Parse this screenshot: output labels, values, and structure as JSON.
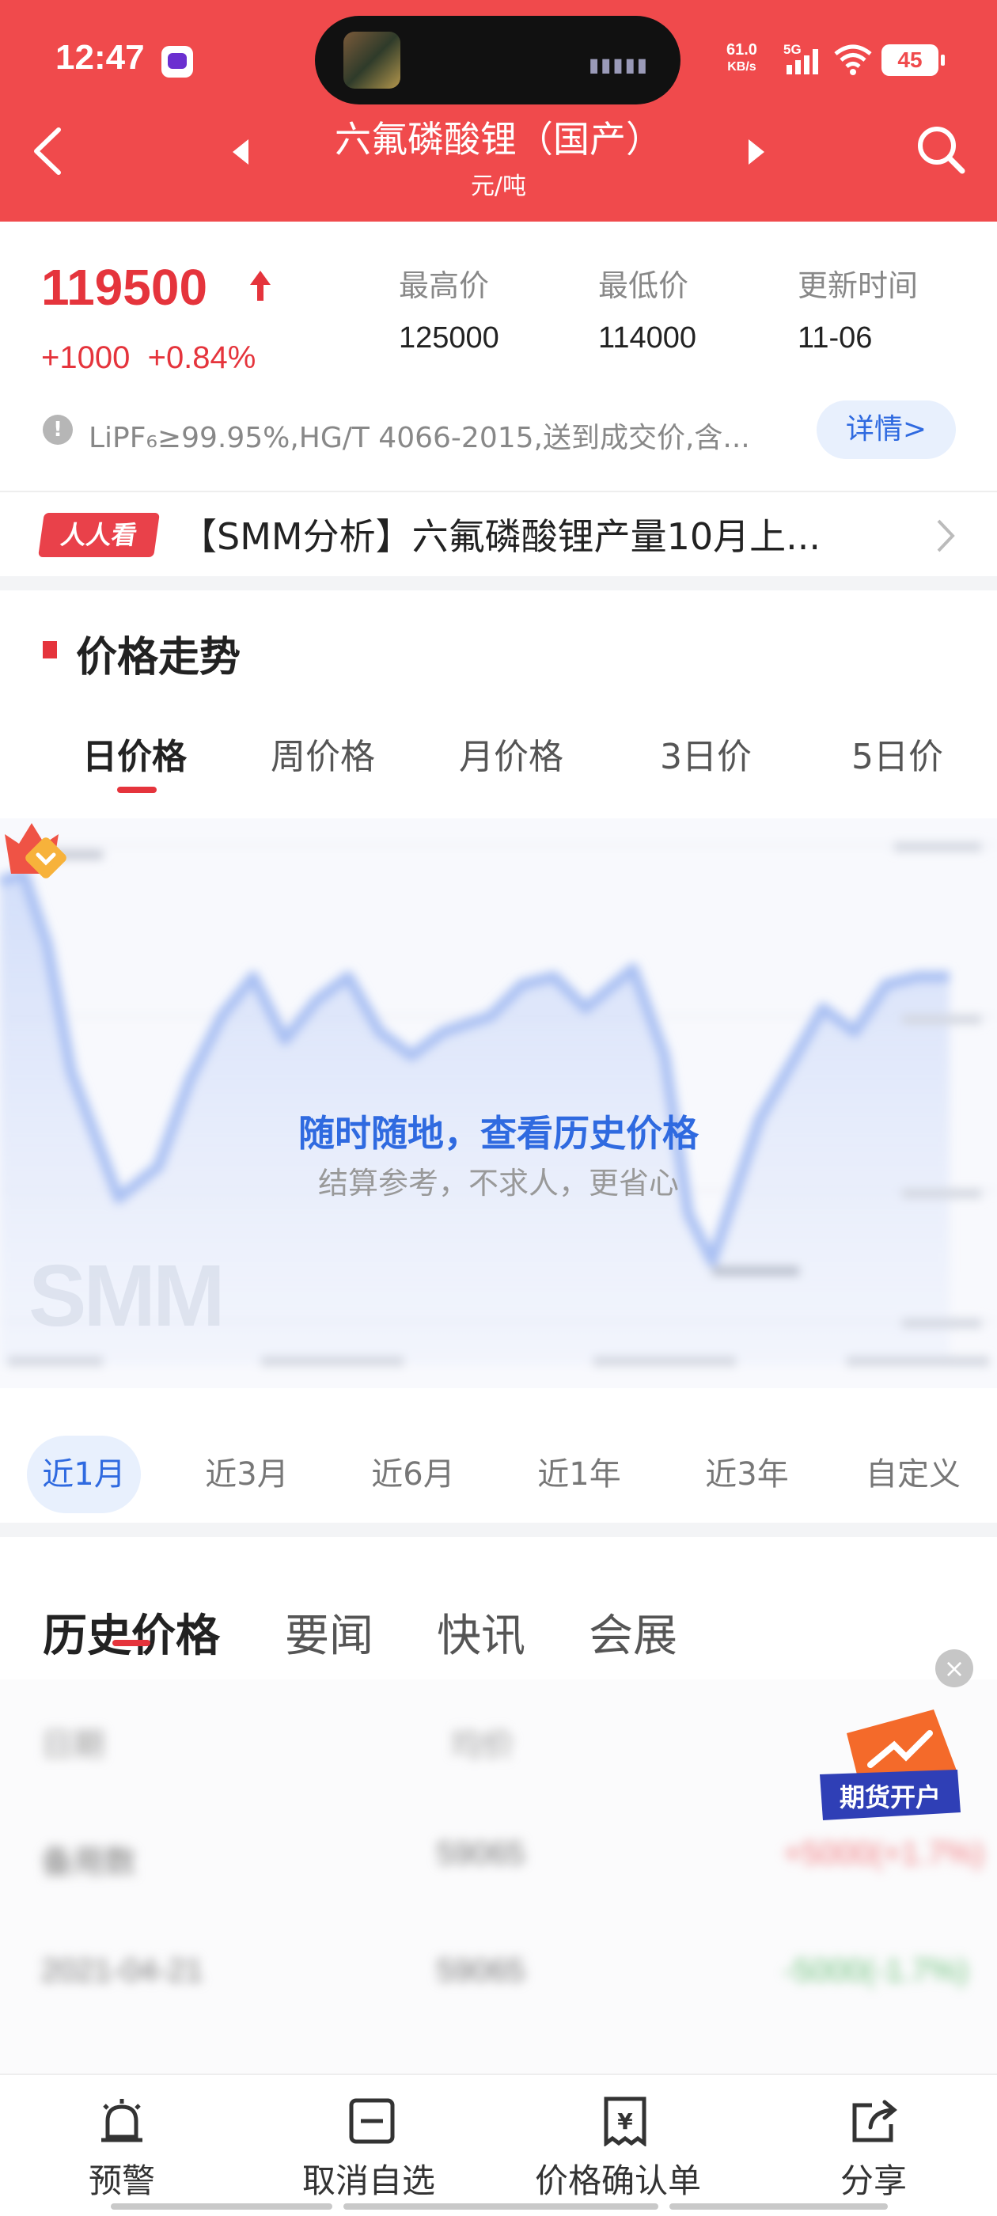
{
  "status_bar": {
    "time": "12:47",
    "net_speed_value": "61.0",
    "net_speed_unit": "KB/s",
    "network": "5G",
    "battery": "45"
  },
  "header": {
    "title": "六氟磷酸锂（国产）",
    "unit": "元/吨"
  },
  "quote": {
    "price": "119500",
    "change_abs": "+1000",
    "change_pct": "+0.84%",
    "stats": [
      {
        "label": "最高价",
        "value": "125000"
      },
      {
        "label": "最低价",
        "value": "114000"
      },
      {
        "label": "更新时间",
        "value": "11-06"
      }
    ],
    "spec_text": "LiPF₆≥99.95%,HG/T 4066-2015,送到成交价,含...",
    "detail_label": "详情>"
  },
  "news": {
    "badge": "人人看",
    "headline": "【SMM分析】六氟磷酸锂产量10月上..."
  },
  "trend": {
    "title": "价格走势",
    "tabs": [
      "日价格",
      "周价格",
      "月价格",
      "3日价",
      "5日价"
    ],
    "promo_title": "随时随地，查看历史价格",
    "promo_subtitle": "结算参考，不求人，更省心",
    "watermark": "SMM"
  },
  "ranges": [
    "近1月",
    "近3月",
    "近6月",
    "近1年",
    "近3年",
    "自定义"
  ],
  "content_tabs": [
    "历史价格",
    "要闻",
    "快讯",
    "会展"
  ],
  "history_table": {
    "rows": [
      [
        "日期",
        "均价",
        ""
      ],
      [
        "备用数",
        "59065",
        "+5000(+1.7%)"
      ],
      [
        "2021-04-21",
        "59065",
        "-5000(-1.7%)"
      ]
    ]
  },
  "promo_badge": "期货开户",
  "bottom_nav": [
    {
      "label": "预警",
      "icon": "alarm-bell-icon"
    },
    {
      "label": "取消自选",
      "icon": "remove-watchlist-icon"
    },
    {
      "label": "价格确认单",
      "icon": "price-receipt-icon"
    },
    {
      "label": "分享",
      "icon": "share-icon"
    }
  ],
  "colors": {
    "header_red": "#f04a4c",
    "price_red": "#e5343c",
    "accent_blue": "#2f6ae0"
  }
}
